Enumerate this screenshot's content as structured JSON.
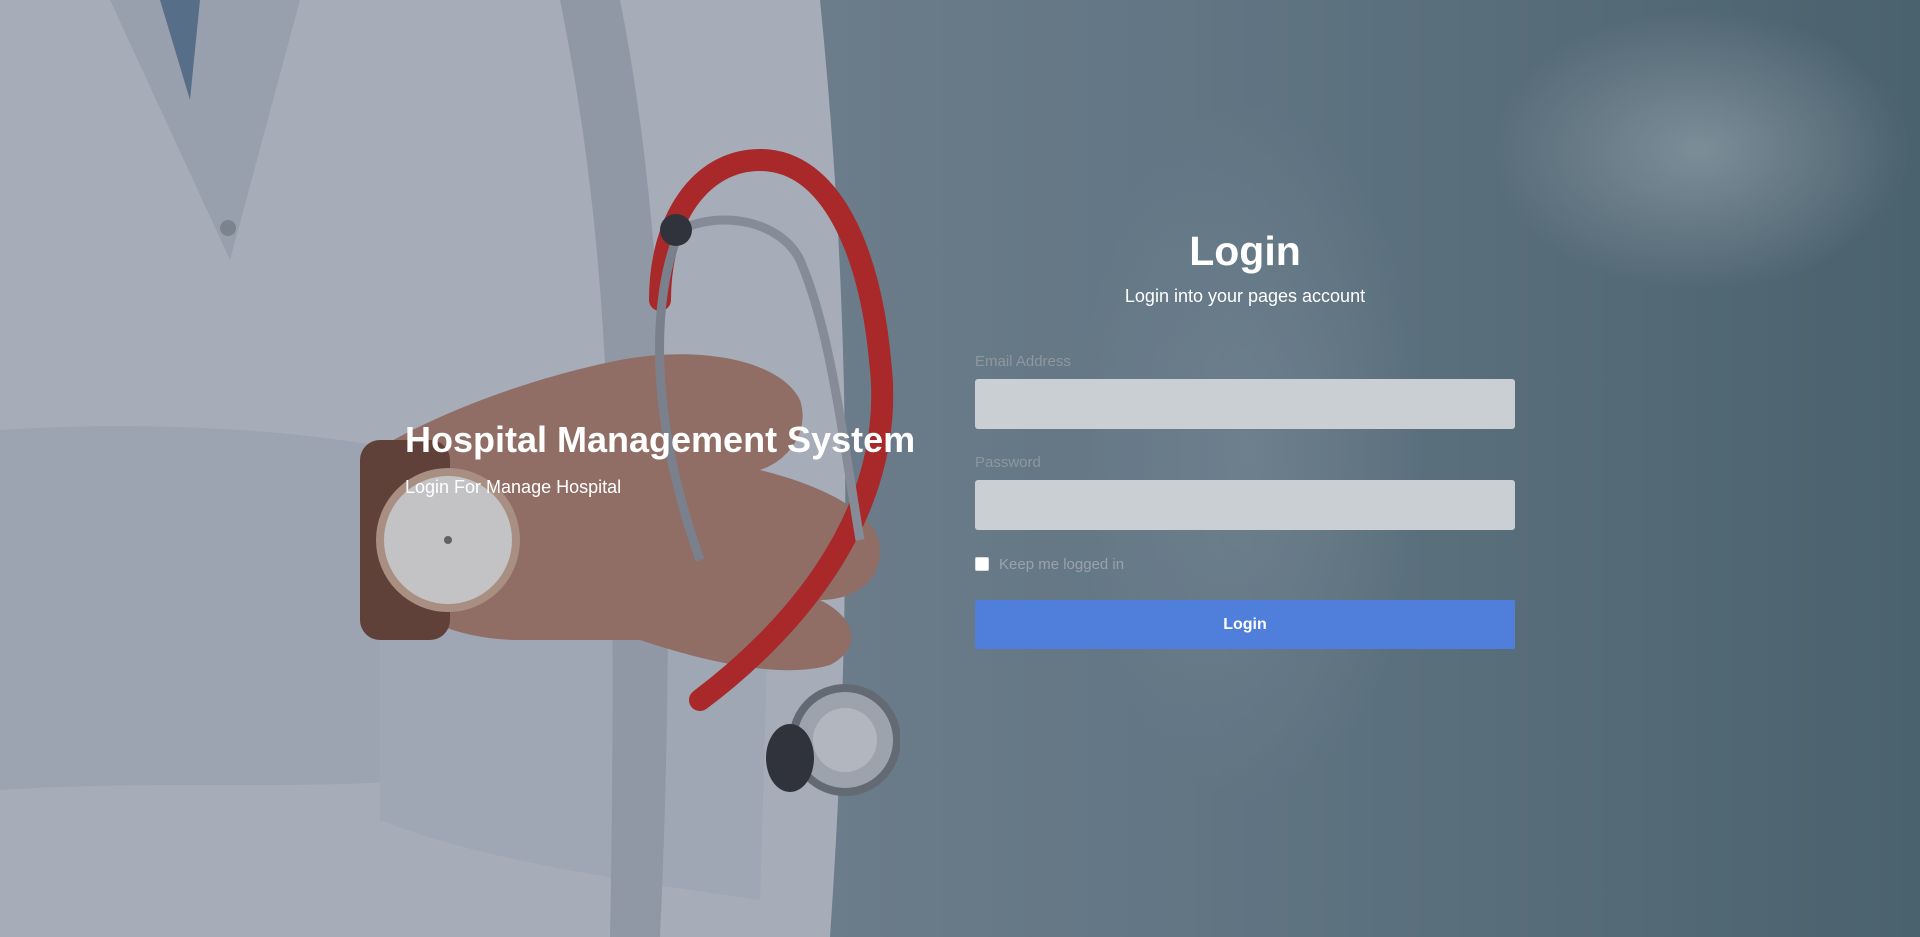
{
  "hero": {
    "title": "Hospital Management System",
    "subtitle": "Login For Manage Hospital"
  },
  "login": {
    "title": "Login",
    "subtitle": "Login into your pages account",
    "email_label": "Email Address",
    "email_value": "",
    "password_label": "Password",
    "password_value": "",
    "remember_label": "Keep me logged in",
    "remember_checked": false,
    "button_label": "Login"
  },
  "theme": {
    "accent": "#4f7fdb",
    "input_bg": "#c9cfd3",
    "stethoscope": "#c8201c"
  },
  "background": {
    "image_subject": "doctor in white coat holding red stethoscope, wearing wristwatch"
  }
}
